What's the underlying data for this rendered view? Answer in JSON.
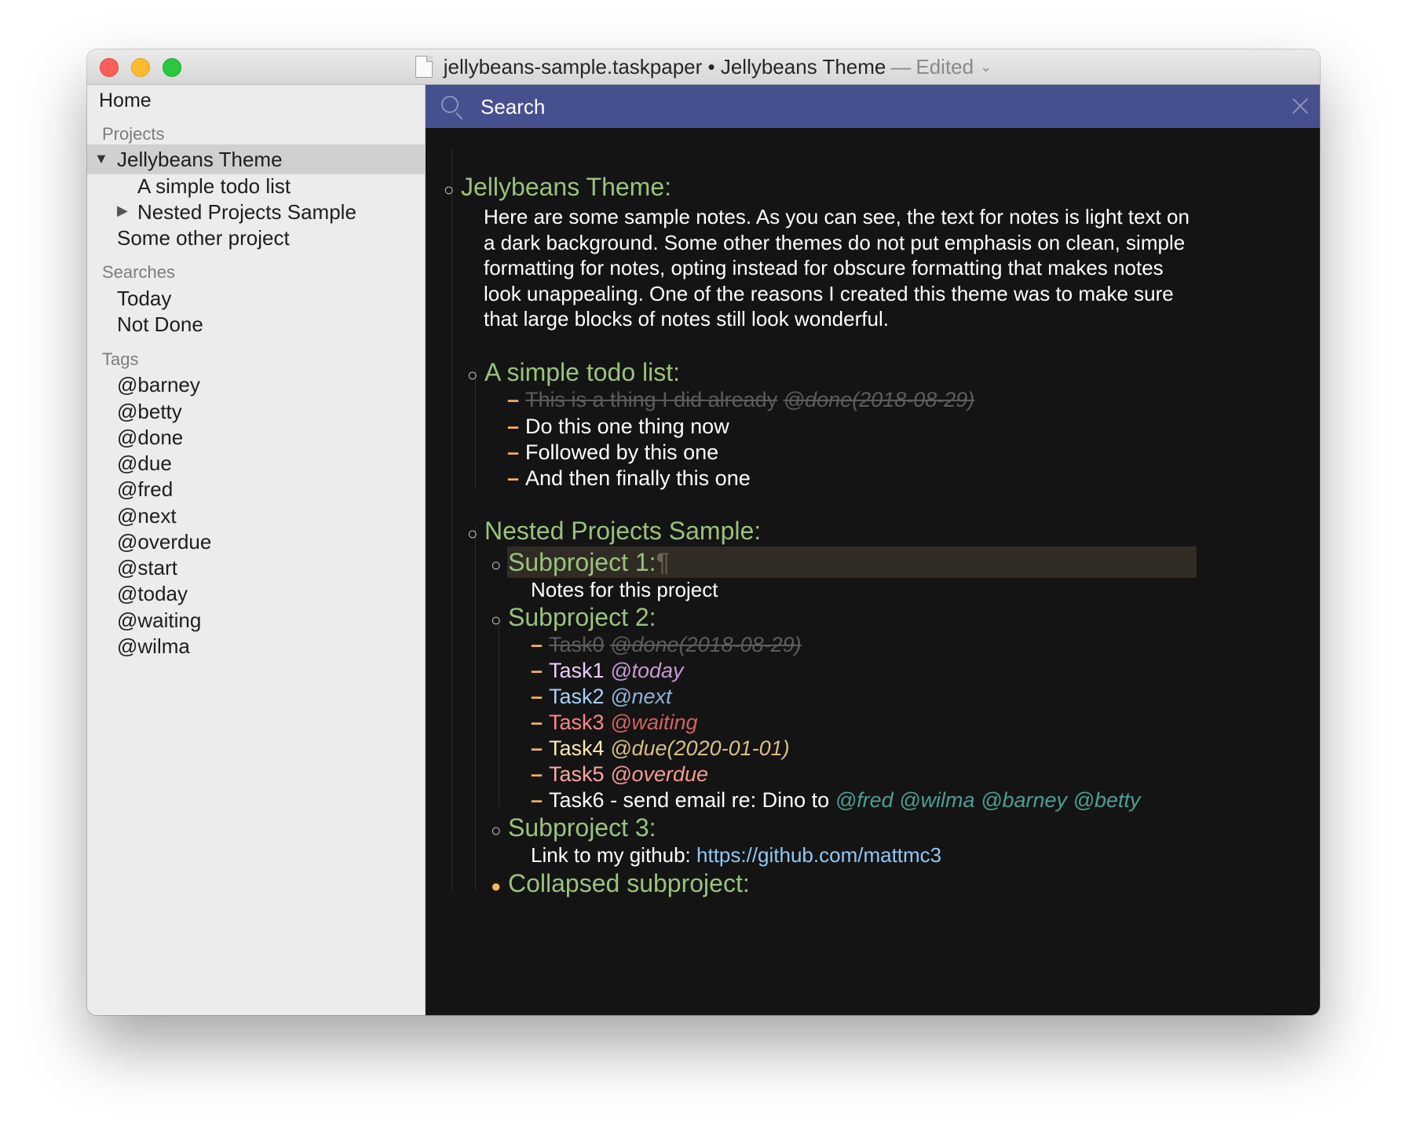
{
  "window": {
    "title": "jellybeans-sample.taskpaper • Jellybeans Theme",
    "title_separator": "—",
    "edited_label": "Edited"
  },
  "sidebar": {
    "home": "Home",
    "projects_header": "Projects",
    "projects": [
      "Jellybeans Theme",
      "A simple todo list",
      "Nested Projects Sample",
      "Some other project"
    ],
    "searches_header": "Searches",
    "searches": [
      "Today",
      "Not Done"
    ],
    "tags_header": "Tags",
    "tags": [
      "@barney",
      "@betty",
      "@done",
      "@due",
      "@fred",
      "@next",
      "@overdue",
      "@start",
      "@today",
      "@waiting",
      "@wilma"
    ]
  },
  "search": {
    "placeholder": "Search"
  },
  "document": {
    "project_main": "Jellybeans Theme:",
    "note_main": "Here are some sample notes. As you can see, the text for notes is light text on a dark background. Some other themes do not put emphasis on clean, simple formatting for notes, opting instead for obscure formatting that makes notes look unappealing. One of the reasons I created this theme was to make sure that large blocks of notes still look wonderful.",
    "todo_project": "A simple todo list:",
    "todo_items": [
      {
        "text": "This is a thing I did already",
        "tag": "@done(2018-08-29)"
      },
      {
        "text": "Do this one thing now"
      },
      {
        "text": "Followed by this one"
      },
      {
        "text": "And then finally this one"
      }
    ],
    "nested_project": "Nested Projects Sample:",
    "sub1": "Subproject 1:",
    "pilcrow": "¶",
    "sub1_note": "Notes for this project",
    "sub2": "Subproject 2:",
    "sub2_tasks": [
      {
        "text": "Task0",
        "tag": "@done(2018-08-29)"
      },
      {
        "text": "Task1",
        "tag": "@today"
      },
      {
        "text": "Task2",
        "tag": "@next"
      },
      {
        "text": "Task3",
        "tag": "@waiting"
      },
      {
        "text": "Task4",
        "tag": "@due(2020-01-01)"
      },
      {
        "text": "Task5",
        "tag": "@overdue"
      },
      {
        "text": "Task6 - send email re: Dino to",
        "tag": "@fred @wilma @barney @betty"
      }
    ],
    "sub3": "Subproject 3:",
    "sub3_note_label": "Link to my github:",
    "sub3_link": "https://github.com/mattmc3",
    "collapsed": "Collapsed subproject:",
    "dash": "–",
    "bullet_open": "○",
    "bullet_collapsed": "●"
  },
  "colors": {
    "search_bar": "#47508e",
    "editor_bg": "#141414",
    "project": "#99c27e",
    "dash": "#f6b35f",
    "link": "#8fc8f5"
  }
}
